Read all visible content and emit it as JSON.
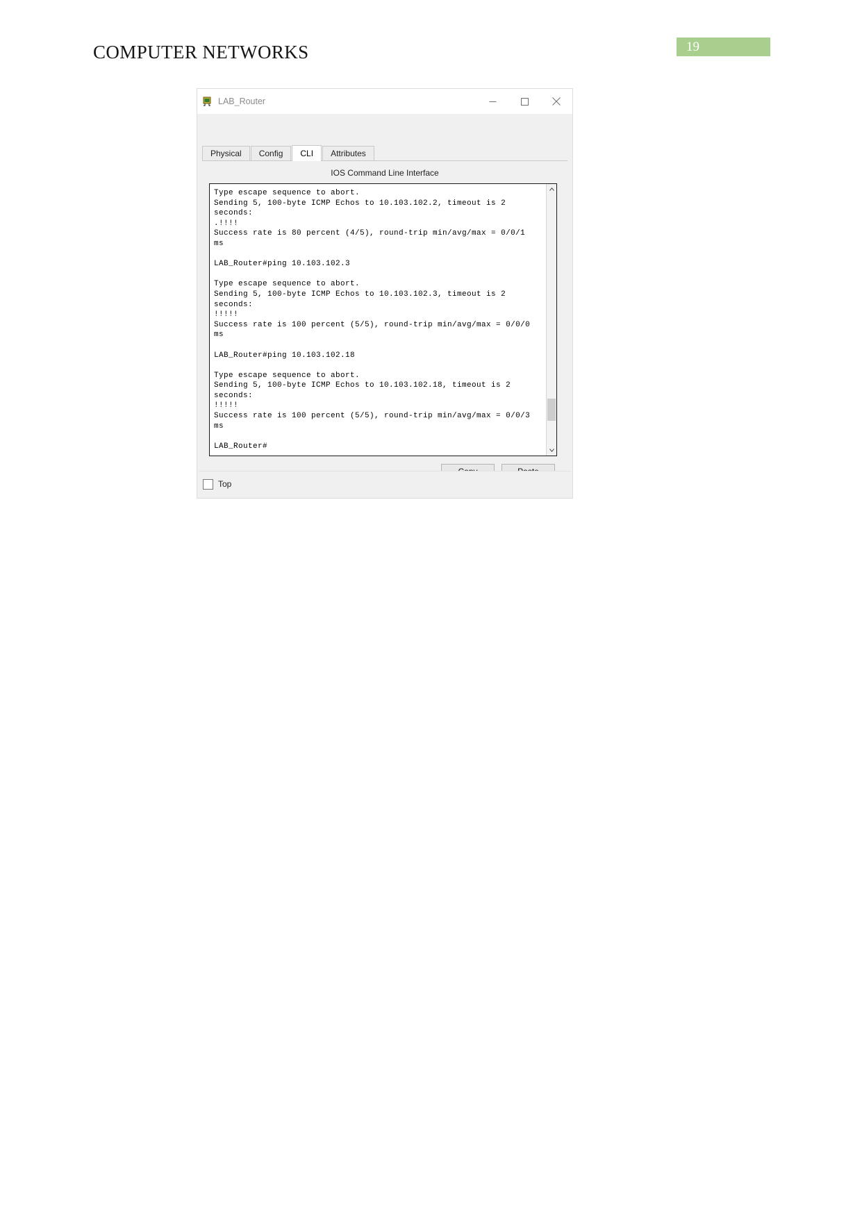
{
  "document": {
    "header_title": "COMPUTER NETWORKS",
    "page_number": "19",
    "badge_color": "#a9cf8f"
  },
  "window": {
    "title": "LAB_Router",
    "icon": "router-device-icon",
    "controls": {
      "minimize": "minimize-icon",
      "maximize": "maximize-icon",
      "close": "close-icon"
    }
  },
  "tabs": [
    {
      "label": "Physical",
      "active": false
    },
    {
      "label": "Config",
      "active": false
    },
    {
      "label": "CLI",
      "active": true
    },
    {
      "label": "Attributes",
      "active": false
    }
  ],
  "cli": {
    "caption": "IOS Command Line Interface",
    "output": "Type escape sequence to abort.\nSending 5, 100-byte ICMP Echos to 10.103.102.2, timeout is 2\nseconds:\n.!!!!\nSuccess rate is 80 percent (4/5), round-trip min/avg/max = 0/0/1\nms\n\nLAB_Router#ping 10.103.102.3\n\nType escape sequence to abort.\nSending 5, 100-byte ICMP Echos to 10.103.102.3, timeout is 2\nseconds:\n!!!!!\nSuccess rate is 100 percent (5/5), round-trip min/avg/max = 0/0/0\nms\n\nLAB_Router#ping 10.103.102.18\n\nType escape sequence to abort.\nSending 5, 100-byte ICMP Echos to 10.103.102.18, timeout is 2\nseconds:\n!!!!!\nSuccess rate is 100 percent (5/5), round-trip min/avg/max = 0/0/3\nms\n\nLAB_Router#",
    "scrollbar": {
      "up_arrow": "chevron-up-icon",
      "down_arrow": "chevron-down-icon"
    }
  },
  "buttons": {
    "copy": "Copy",
    "paste": "Paste"
  },
  "footer": {
    "top_checkbox_label": "Top",
    "top_checked": false
  }
}
